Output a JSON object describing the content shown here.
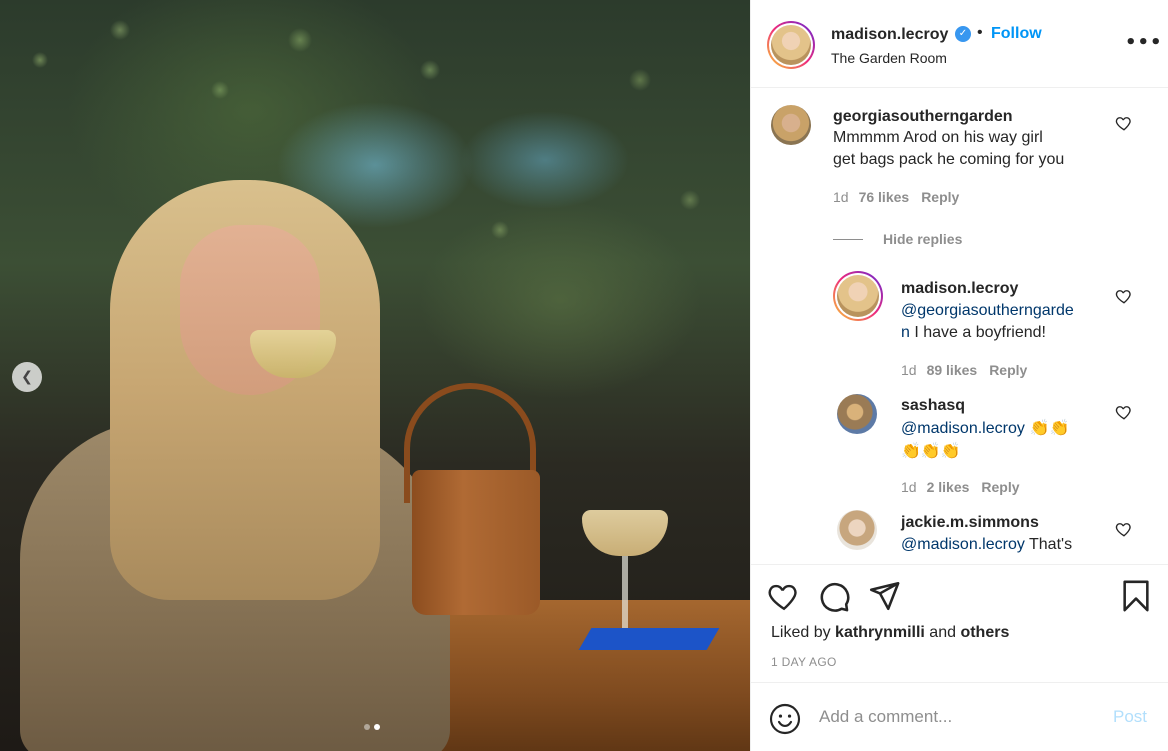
{
  "post": {
    "username": "madison.lecroy",
    "location": "The Garden Room",
    "follow_label": "Follow",
    "bullet": "•",
    "more_label": "•••",
    "verified_glyph": "✓",
    "carousel": {
      "dots": 2,
      "active_index": 1
    }
  },
  "comments": [
    {
      "username": "georgiasoutherngarden",
      "text_lines": [
        "Mmmmm Arod on his way girl",
        "get bags pack he coming for you"
      ],
      "age": "1d",
      "likes": "76 likes",
      "reply": "Reply"
    }
  ],
  "hide_replies_label": "Hide replies",
  "replies": [
    {
      "username": "madison.lecroy",
      "mention_line1": "@georgiasoutherngarde",
      "mention_line2": "n",
      "text": " I have a boyfriend!",
      "age": "1d",
      "likes": "89 likes",
      "reply": "Reply"
    },
    {
      "username": "sashasq",
      "mention": "@madison.lecroy",
      "emoji_line1": " 👏👏",
      "emoji_line2": "👏👏👏",
      "age": "1d",
      "likes": "2 likes",
      "reply": "Reply"
    },
    {
      "username": "jackie.m.simmons",
      "mention": "@madison.lecroy",
      "text": " That's"
    }
  ],
  "actions": {
    "liked_by_prefix": "Liked by ",
    "liked_by_user": "kathrynmilli",
    "liked_by_and": " and ",
    "liked_by_others": "others",
    "time": "1 DAY AGO"
  },
  "add_comment": {
    "placeholder": "Add a comment...",
    "post_label": "Post"
  },
  "icons": {
    "verified": "verified-badge-icon",
    "like": "heart-icon",
    "comment": "comment-bubble-icon",
    "share": "paper-plane-icon",
    "save": "bookmark-icon",
    "emoji": "smiley-icon",
    "more": "more-options-icon",
    "carousel_prev": "chevron-left-icon"
  },
  "colors": {
    "accent": "#0095f6",
    "verified": "#3897f0",
    "muted": "#8e8e8e",
    "post_disabled": "#b2dffc",
    "text": "#262626"
  }
}
